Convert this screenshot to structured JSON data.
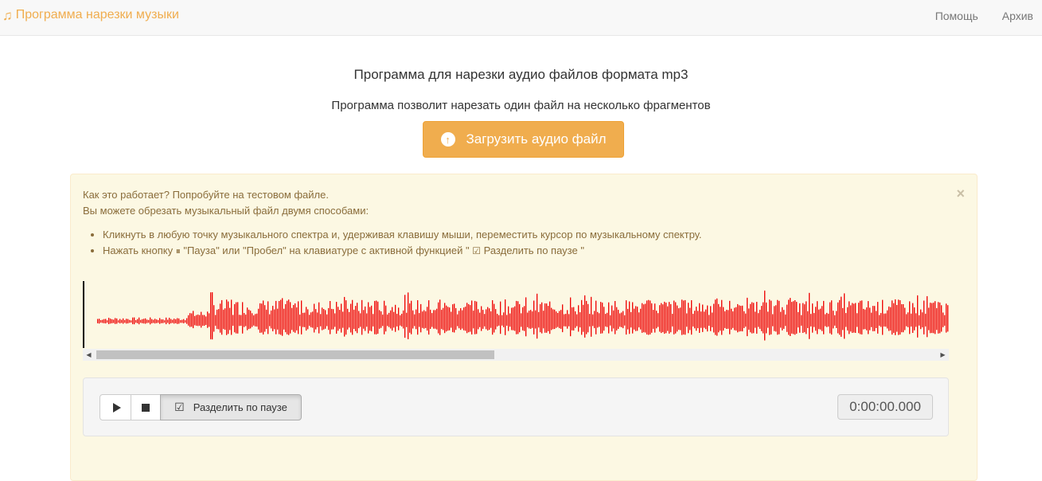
{
  "navbar": {
    "brand_icon": "♫",
    "brand": "Программа нарезки музыки",
    "links": [
      "Помощь",
      "Архив"
    ]
  },
  "header": {
    "title": "Программа для нарезки аудио файлов формата mp3",
    "subtitle": "Программа позволит нарезать один файл на несколько фрагментов"
  },
  "upload": {
    "label": "Загрузить аудио файл",
    "icon": "upload-circle-icon"
  },
  "alert": {
    "close": "×",
    "line1": "Как это работает? Попробуйте на тестовом файле.",
    "line2": "Вы можете обрезать музыкальный файл двумя способами:",
    "bullet1": "Кликнуть в любую точку музыкального спектра и, удерживая клавишу мыши, переместить курсор по музыкальному спектру.",
    "bullet2_a": "Нажать кнопку",
    "bullet2_b": "\"Пауза\" или \"Пробел\" на клавиатуре с активной функцией \"",
    "bullet2_c": "Разделить по паузе \"",
    "pause_glyph": "⏸",
    "check_glyph": "☑"
  },
  "waveform": {
    "color": "#ee0000",
    "cursor_color": "#000000"
  },
  "controls": {
    "split_label": "Разделить по паузе",
    "check_glyph": "☑",
    "timer": "0:00:00.000"
  },
  "colors": {
    "accent": "#f0ad4e",
    "alert_bg": "#fcf8e3",
    "alert_text": "#8a6d3b"
  }
}
